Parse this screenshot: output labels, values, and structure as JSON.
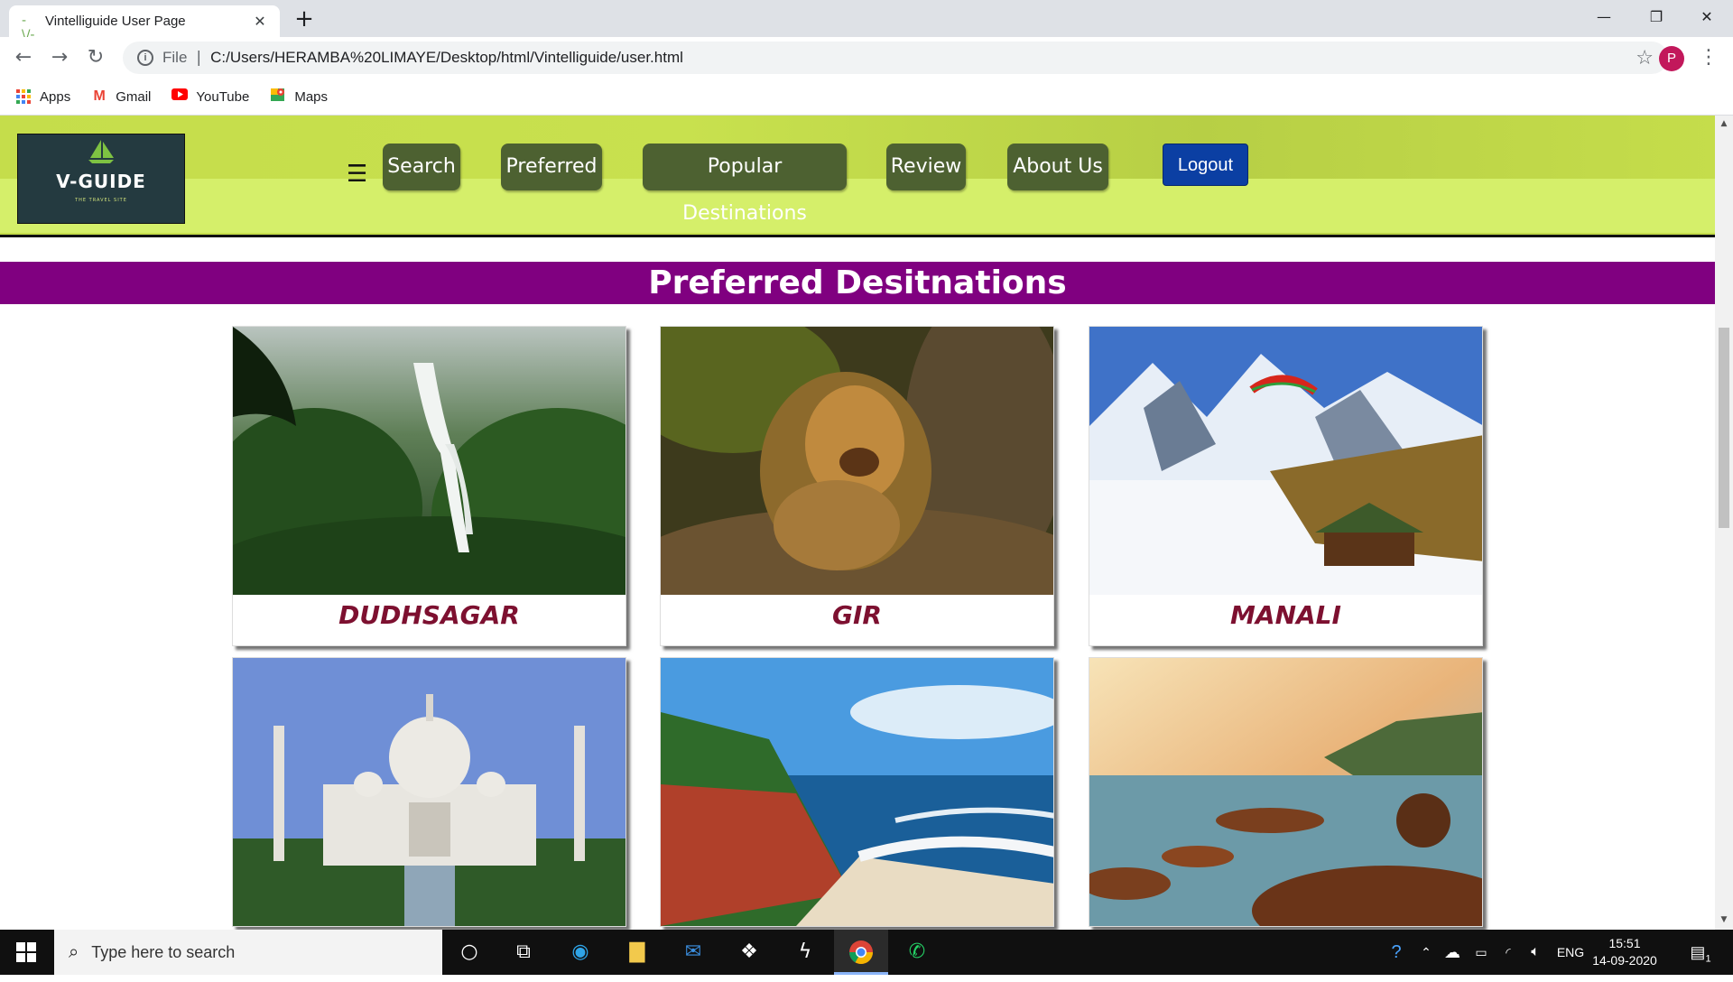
{
  "browser": {
    "tab_title": "Vintelliguide User Page",
    "new_tab": "+",
    "url_protocol": "File",
    "url": "C:/Users/HERAMBA%20LIMAYE/Desktop/html/Vintelliguide/user.html",
    "profile_initial": "P",
    "bookmarks": [
      {
        "label": "Apps",
        "icon": "apps-icon"
      },
      {
        "label": "Gmail",
        "icon": "gmail-icon"
      },
      {
        "label": "YouTube",
        "icon": "youtube-icon"
      },
      {
        "label": "Maps",
        "icon": "maps-icon"
      }
    ]
  },
  "site": {
    "logo_text": "V-GUIDE",
    "logo_tagline": "THE TRAVEL SITE",
    "nav": [
      "Search",
      "Preferred",
      "Popular Destinations",
      "Review",
      "About Us"
    ],
    "logout_label": "Logout",
    "section_title": "Preferred Desitnations",
    "destinations": [
      {
        "name": "DUDHSAGAR",
        "image": "waterfall"
      },
      {
        "name": "GIR",
        "image": "lion"
      },
      {
        "name": "MANALI",
        "image": "snow-mountains"
      },
      {
        "name": "",
        "image": "taj-mahal"
      },
      {
        "name": "",
        "image": "beach-cliff"
      },
      {
        "name": "",
        "image": "sunset-rocks"
      }
    ],
    "colors": {
      "header": "#c8e14e",
      "nav_button": "#4d6131",
      "logout": "#0b3fa3",
      "section_bar": "#800080",
      "caption": "#7d1030"
    }
  },
  "taskbar": {
    "search_placeholder": "Type here to search",
    "language": "ENG",
    "time": "15:51",
    "date": "14-09-2020",
    "notification_count": "1"
  }
}
